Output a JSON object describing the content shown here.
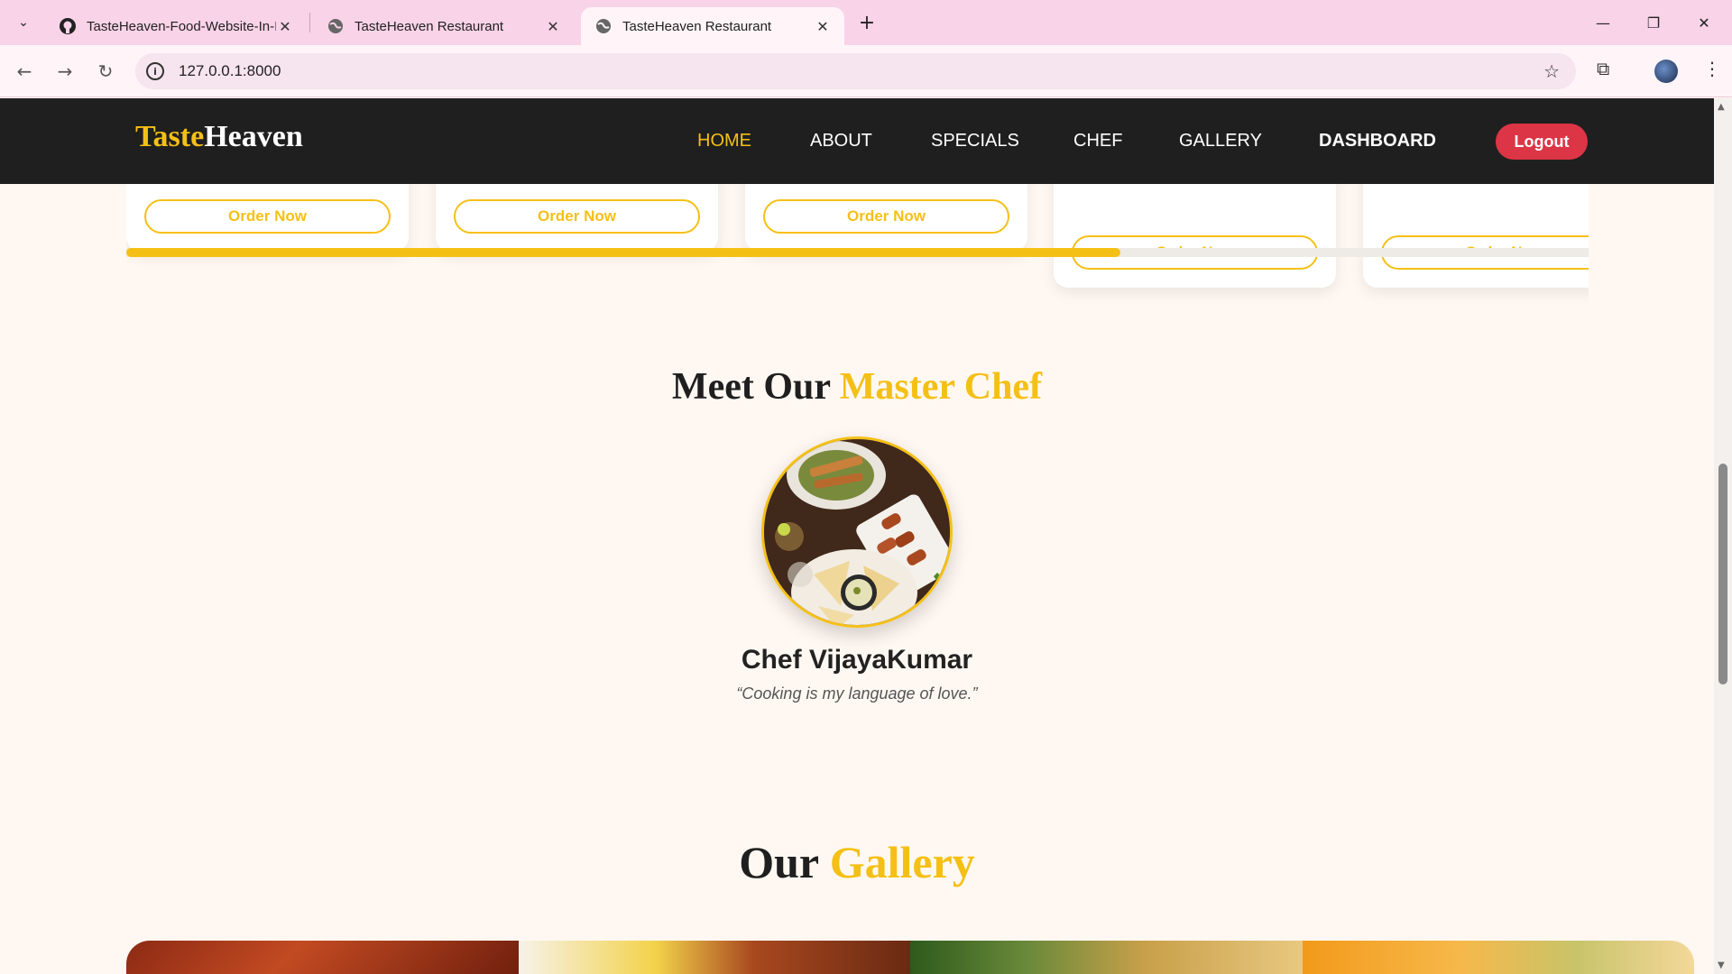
{
  "browser": {
    "tabs": [
      {
        "title": "TasteHeaven-Food-Website-In-I",
        "favicon": "github-icon"
      },
      {
        "title": "TasteHeaven Restaurant",
        "favicon": "globe-icon"
      },
      {
        "title": "TasteHeaven Restaurant",
        "favicon": "globe-icon",
        "active": true
      }
    ],
    "url": "127.0.0.1:8000"
  },
  "site": {
    "logo_first": "Taste",
    "logo_second": "Heaven",
    "nav": {
      "home": "HOME",
      "about": "ABOUT",
      "specials": "SPECIALS",
      "chef": "CHEF",
      "gallery": "GALLERY",
      "dashboard": "DASHBOARD"
    },
    "logout": "Logout"
  },
  "menu_cards": {
    "order_label": "Order Now",
    "scroll_progress": 0.68
  },
  "chef_section": {
    "title_plain": "Meet Our ",
    "title_highlight": "Master Chef",
    "name": "Chef VijayaKumar",
    "quote": "“Cooking is my language of love.”"
  },
  "gallery_section": {
    "title_plain": "Our ",
    "title_highlight": "Gallery"
  },
  "colors": {
    "accent": "#f5c016",
    "nav_bg": "#1f1f1f",
    "logout": "#dc3545",
    "page_bg": "#fff8f2"
  }
}
